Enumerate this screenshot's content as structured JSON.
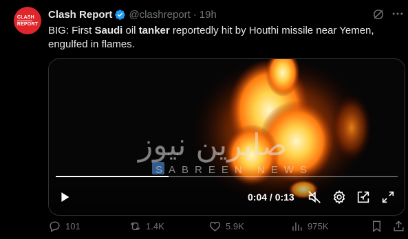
{
  "tweet": {
    "avatar_text_line1": "CLASH",
    "avatar_text_line2": "REPORT",
    "display_name": "Clash Report",
    "handle": "@clashreport",
    "separator": "·",
    "time": "19h",
    "text_segments": [
      {
        "text": "BIG: First ",
        "bold": false
      },
      {
        "text": "Saudi",
        "bold": true
      },
      {
        "text": " oil ",
        "bold": false
      },
      {
        "text": "tanker",
        "bold": true
      },
      {
        "text": " reportedly hit by Houthi missile near Yemen, engulfed in flames.",
        "bold": false
      }
    ]
  },
  "video": {
    "watermark_arabic": "صابرين نيوز",
    "watermark_english": "SABREEN NEWS",
    "time_display": "0:04 / 0:13",
    "progress": 0.33,
    "muted": true
  },
  "actions": {
    "replies": "101",
    "reposts": "1.4K",
    "likes": "5.9K",
    "views": "975K"
  },
  "colors": {
    "background": "#000000",
    "text": "#e7e9ea",
    "muted": "#71767b",
    "verified": "#1d9bf0",
    "avatar": "#e0262b"
  }
}
